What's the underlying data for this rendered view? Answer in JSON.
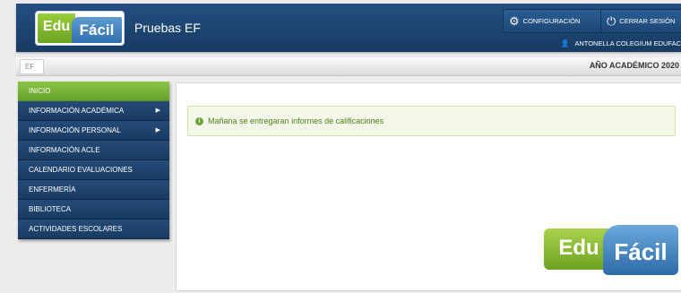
{
  "header": {
    "logo_left": "Edu",
    "logo_right": "Fácil",
    "title": "Pruebas EF",
    "config_label": "CONFIGURACIÓN",
    "logout_label": "CERRAR SESIÓN",
    "user": "ANTONELLA COLEGIUM EDUFAC"
  },
  "breadcrumb": {
    "item": "EF",
    "year": "AÑO ACADÉMICO  2020"
  },
  "sidebar": {
    "items": [
      {
        "label": "INICIO"
      },
      {
        "label": "INFORMACIÓN ACADÉMICA"
      },
      {
        "label": "INFORMACIÓN PERSONAL"
      },
      {
        "label": "INFORMACIÓN ACLE"
      },
      {
        "label": "CALENDARIO EVALUACIONES"
      },
      {
        "label": "ENFERMERÍA"
      },
      {
        "label": "BIBLIOTECA"
      },
      {
        "label": "ACTIVIDADES ESCOLARES"
      }
    ]
  },
  "main": {
    "alert": "Mañana se entregaran informes de calificaciones",
    "logo_left": "Edu",
    "logo_right": "Fácil"
  },
  "icons": {
    "config": "gears-icon",
    "logout": "power-icon",
    "user": "user-icon",
    "alert": "info-icon",
    "submenu": "chevron-right-icon"
  },
  "colors": {
    "header_bg": "#1d4775",
    "active_menu": "#77b234",
    "menu_bg": "#1e3e66",
    "alert_bg": "#f3f8e8",
    "alert_text": "#4d7f1a"
  }
}
